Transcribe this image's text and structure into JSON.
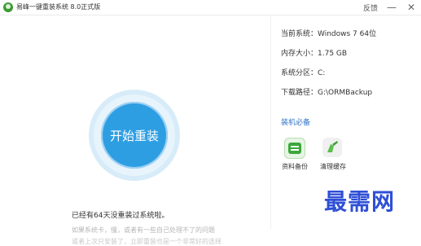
{
  "app": {
    "title": "易峰一键重装系统 8.0正式版",
    "feedback_label": "反馈",
    "minimize_glyph": "—",
    "close_glyph": "✕"
  },
  "main": {
    "start_button": "开始重装",
    "message": "已经有64天没重装过系统啦。",
    "tip_line1": "如果系统卡，慢，或者有一些自己处理不了的问题",
    "tip_line2": "或者上次只安装了，立即重装也是一个非常好的选择"
  },
  "system_info": [
    {
      "label": "当前系统：",
      "value": "Windows 7 64位"
    },
    {
      "label": "内存大小：",
      "value": "1.75 GB"
    },
    {
      "label": "系统分区：",
      "value": "C:"
    },
    {
      "label": "下载路径：",
      "value": "G:\\ORMBackup"
    }
  ],
  "essentials": {
    "title": "装机必备",
    "tools": [
      {
        "label": "资料备份",
        "icon": "backup-icon",
        "color": "#3aa83a"
      },
      {
        "label": "清理缓存",
        "icon": "clean-icon",
        "color": "#5bbf4b"
      }
    ]
  },
  "watermark": "最需网"
}
